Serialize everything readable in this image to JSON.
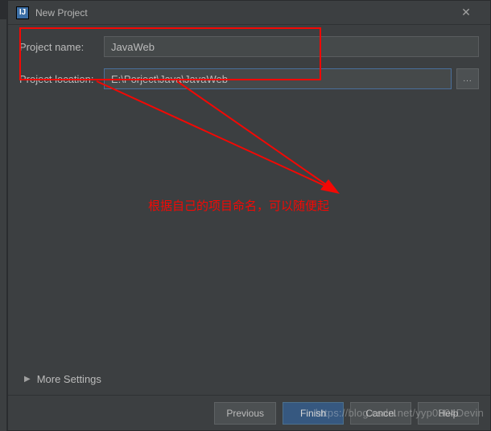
{
  "titlebar": {
    "icon_text": "IJ",
    "title": "New Project",
    "close_glyph": "✕"
  },
  "form": {
    "name_label": "Project name:",
    "name_value": "JavaWeb",
    "location_label": "Project location:",
    "location_value": "E:\\Porject\\Java\\JavaWeb",
    "browse_label": "..."
  },
  "annotation": {
    "text": "根据自己的项目命名，可以随便起"
  },
  "more_settings": {
    "arrow": "▶",
    "label": "More Settings"
  },
  "footer": {
    "previous": "Previous",
    "finish": "Finish",
    "cancel": "Cancel",
    "help": "Help"
  },
  "watermark": "https://blog.csdn.net/yyp0304Devin"
}
